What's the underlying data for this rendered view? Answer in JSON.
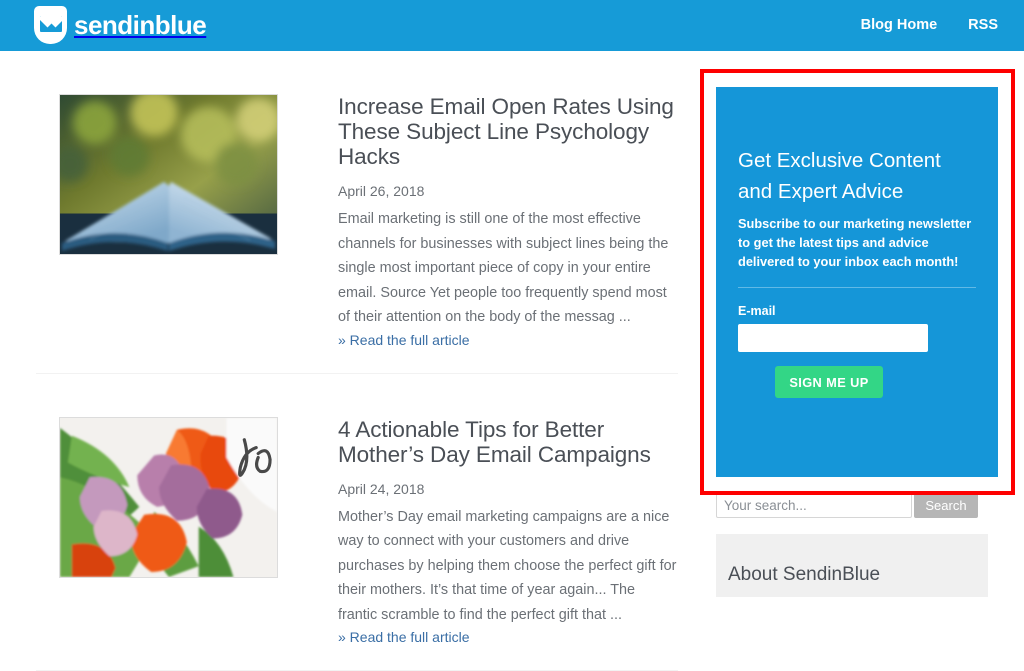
{
  "header": {
    "logo_text": "sendinblue",
    "logo_icon": "envelope-shield-icon",
    "nav": [
      {
        "label": "Blog Home"
      },
      {
        "label": "RSS"
      }
    ]
  },
  "articles": [
    {
      "title": "Increase Email Open Rates Using These Subject Line Psychology Hacks",
      "date": "April 26, 2018",
      "excerpt": "Email marketing is still one of the most effective channels for businesses with subject lines being the single most important piece of copy in your entire email. Source Yet people too frequently spend most of their attention on the body of the messag ...",
      "read_more": "» Read the full article",
      "thumb_alt": "open-book-outdoors-photo"
    },
    {
      "title": "4 Actionable Tips for Better Mother’s Day Email Campaigns",
      "date": "April 24, 2018",
      "excerpt": "Mother’s Day email marketing campaigns are a nice way to connect with your customers and drive purchases by helping them choose the perfect gift for their mothers. It’s that time of year again... The frantic scramble to find the perfect gift that ...",
      "read_more": "» Read the full article",
      "thumb_alt": "orange-purple-tulips-photo"
    }
  ],
  "sidebar": {
    "cta": {
      "title": "Get Exclusive Content and Expert Advice",
      "subtitle": "Subscribe to our marketing newsletter to get the latest tips and advice delivered to your inbox each month!",
      "email_label": "E-mail",
      "email_value": "",
      "email_placeholder": "",
      "button_label": "SIGN ME UP"
    },
    "search": {
      "placeholder": "Your search...",
      "value": "",
      "button_label": "Search"
    },
    "about": {
      "title": "About SendinBlue"
    }
  },
  "colors": {
    "brand_blue": "#169bd7",
    "cta_blue": "#1596d8",
    "signup_green": "#33d686",
    "highlight_red": "#fe0000",
    "link_blue": "#3a6ea5",
    "text_dark": "#4a4f56",
    "text_muted": "#6b7076",
    "about_bg": "#f0f0f0",
    "search_btn_gray": "#b6b6b6"
  }
}
